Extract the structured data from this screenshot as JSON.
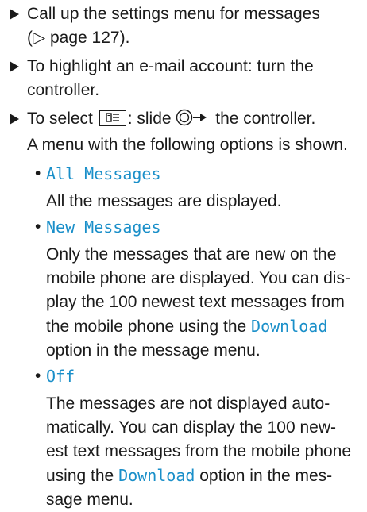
{
  "steps": [
    {
      "text_line1": "Call up the settings menu for messages",
      "text_line2_prefix": "(",
      "page_ref_symbol": "▷",
      "page_ref_text": " page 127)."
    },
    {
      "text_line1": "To highlight an e-mail account: turn the",
      "text_line2": "controller."
    },
    {
      "text_prefix": "To select ",
      "text_mid": ": slide ",
      "text_suffix": " the controller.",
      "text_line2": "A menu with the following options is shown."
    }
  ],
  "options": [
    {
      "title": "All Messages",
      "desc_lines": [
        "All the messages are displayed."
      ]
    },
    {
      "title": "New Messages",
      "desc_lines": [
        "Only the messages that are new on the",
        "mobile phone are displayed. You can dis-",
        "play the 100 newest text messages from"
      ],
      "desc_prefix_last": "the mobile phone using the ",
      "desc_keyword": "Download",
      "desc_line_after": "option in the message menu."
    },
    {
      "title": "Off",
      "desc_lines": [
        "The messages are not displayed auto-",
        "matically. You can display the 100 new-",
        "est text messages from the mobile phone"
      ],
      "desc_prefix_last": "using the ",
      "desc_keyword": "Download",
      "desc_suffix_last": " option in the mes-",
      "desc_line_after": "sage menu."
    }
  ],
  "bullet": "•",
  "icon_names": {
    "arrow": "arrow-icon",
    "menu_icon": "phone-menu-icon",
    "controller": "controller-slide-icon"
  },
  "colors": {
    "keyword": "#1a8fc9",
    "text": "#1a1a1a"
  }
}
